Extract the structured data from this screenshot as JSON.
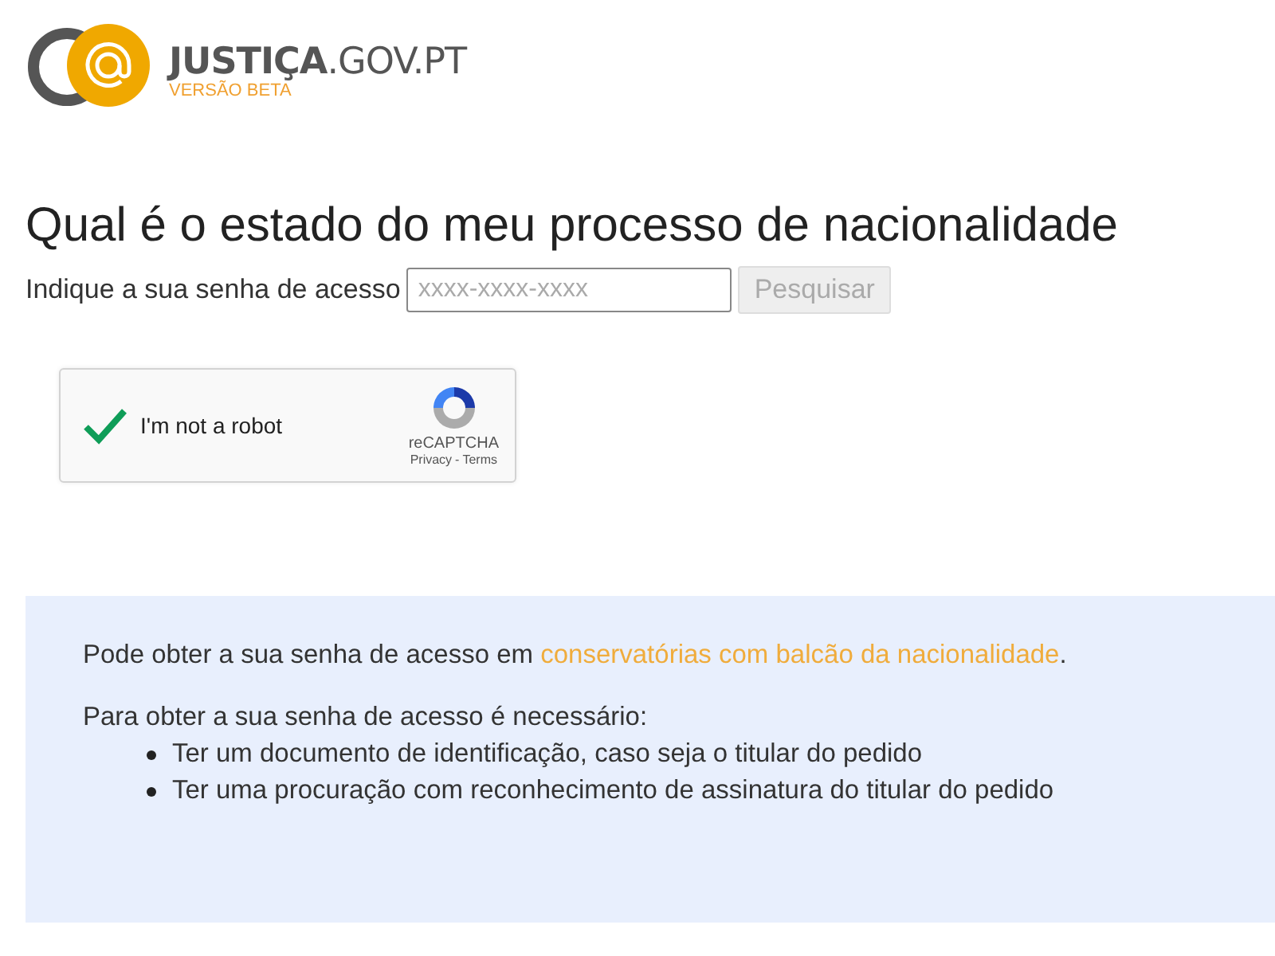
{
  "logo": {
    "name": "**JUSTIÇA**.GOV.PT",
    "tagline": "VERSÃO BETA"
  },
  "heading": "Qual é o estado do meu processo de nacionalidade",
  "search": {
    "label": "Indique a sua senha de acesso",
    "placeholder": "xxxx-xxxx-xxxx",
    "button": "Pesquisar",
    "button_disabled": true
  },
  "captcha": {
    "label": "I'm not a robot",
    "checked": true,
    "brand": "reCAPTCHA",
    "privacy": "Privacy",
    "separator": "-",
    "terms": "Terms"
  },
  "info": {
    "intro_before": "Pode obter a sua senha de acesso em ",
    "intro_link": "conservatórias com balcão da nacionalidade",
    "intro_after": ".",
    "requirements_title": "Para obter a sua senha de acesso é necessário:",
    "requirements": [
      "Ter um documento de identificação, caso seja o titular do pedido",
      "Ter uma procuração com reconhecimento de assinatura do titular do pedido"
    ]
  }
}
